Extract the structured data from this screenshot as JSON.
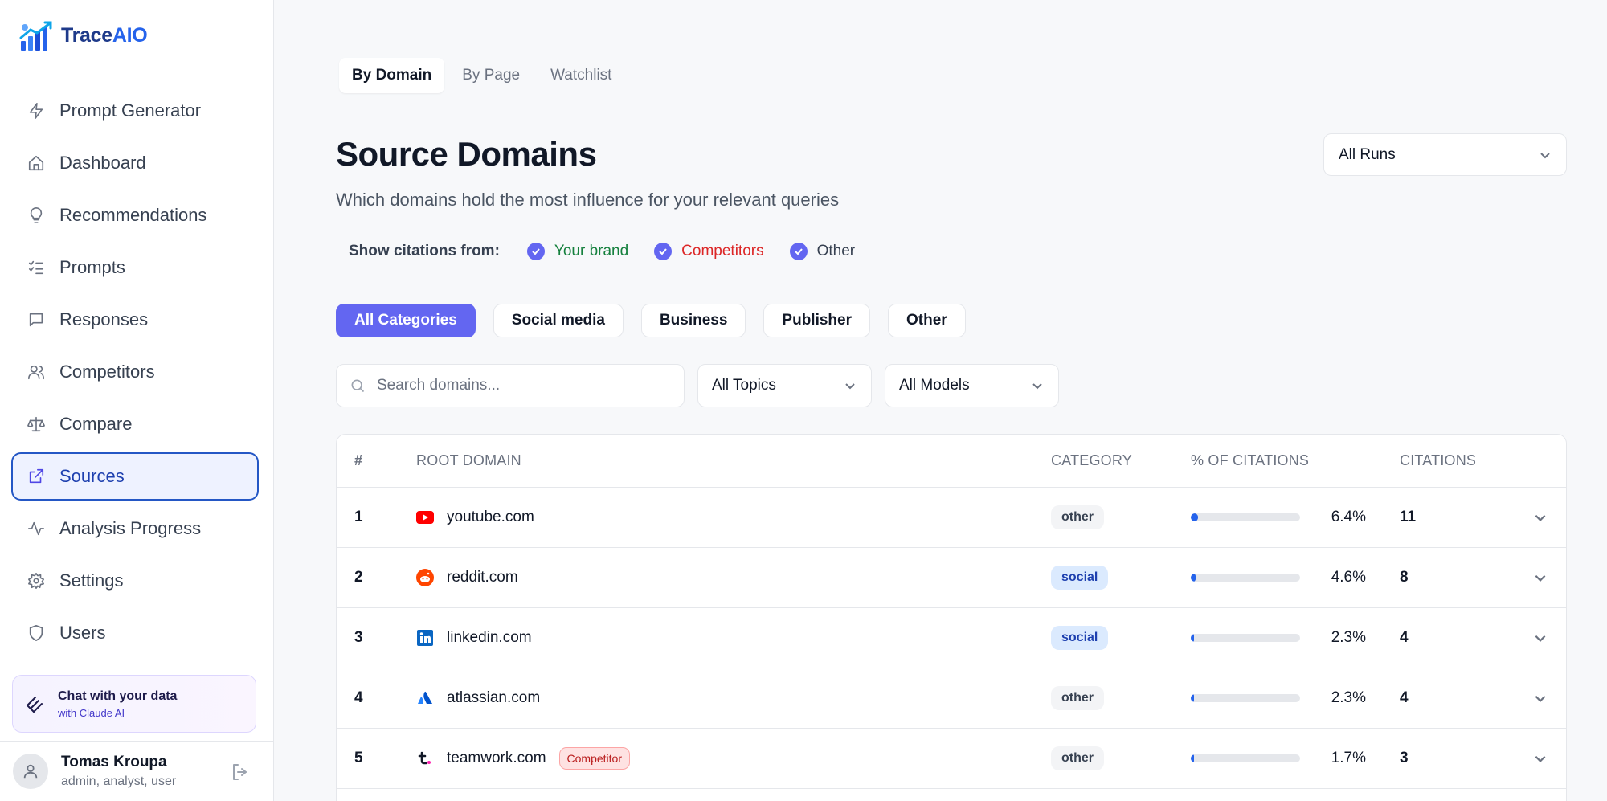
{
  "brand": {
    "name_prefix": "Trace",
    "name_suffix": "AIO"
  },
  "nav": [
    {
      "label": "Prompt Generator",
      "icon": "bolt-icon"
    },
    {
      "label": "Dashboard",
      "icon": "home-icon"
    },
    {
      "label": "Recommendations",
      "icon": "lightbulb-icon"
    },
    {
      "label": "Prompts",
      "icon": "checklist-icon"
    },
    {
      "label": "Responses",
      "icon": "message-icon"
    },
    {
      "label": "Competitors",
      "icon": "users-icon"
    },
    {
      "label": "Compare",
      "icon": "scale-icon"
    },
    {
      "label": "Sources",
      "icon": "external-link-icon",
      "active": true
    },
    {
      "label": "Analysis Progress",
      "icon": "activity-icon"
    },
    {
      "label": "Settings",
      "icon": "gear-icon"
    },
    {
      "label": "Users",
      "icon": "shield-icon"
    }
  ],
  "chat": {
    "title": "Chat with your data",
    "subtitle": "with Claude AI"
  },
  "user": {
    "name": "Tomas Kroupa",
    "roles": "admin, analyst, user"
  },
  "tabs": [
    "By Domain",
    "By Page",
    "Watchlist"
  ],
  "header": {
    "title": "Source Domains",
    "subtitle": "Which domains hold the most influence for your relevant queries",
    "runs_select": "All Runs"
  },
  "citations_filter": {
    "label": "Show citations from:",
    "options": [
      "Your brand",
      "Competitors",
      "Other"
    ]
  },
  "categories": [
    "All Categories",
    "Social media",
    "Business",
    "Publisher",
    "Other"
  ],
  "filters": {
    "search_placeholder": "Search domains...",
    "topics": "All Topics",
    "models": "All Models"
  },
  "table": {
    "headers": [
      "#",
      "ROOT DOMAIN",
      "CATEGORY",
      "% OF CITATIONS",
      "CITATIONS"
    ],
    "rows": [
      {
        "num": "1",
        "domain": "youtube.com",
        "category": "other",
        "pct": "6.4%",
        "pct_value": 6.4,
        "citations": "11",
        "competitor": ""
      },
      {
        "num": "2",
        "domain": "reddit.com",
        "category": "social",
        "pct": "4.6%",
        "pct_value": 4.6,
        "citations": "8",
        "competitor": ""
      },
      {
        "num": "3",
        "domain": "linkedin.com",
        "category": "social",
        "pct": "2.3%",
        "pct_value": 2.3,
        "citations": "4",
        "competitor": ""
      },
      {
        "num": "4",
        "domain": "atlassian.com",
        "category": "other",
        "pct": "2.3%",
        "pct_value": 2.3,
        "citations": "4",
        "competitor": ""
      },
      {
        "num": "5",
        "domain": "teamwork.com",
        "category": "other",
        "pct": "1.7%",
        "pct_value": 1.7,
        "citations": "3",
        "competitor": "Competitor"
      }
    ]
  },
  "colors": {
    "accent": "#6366f1",
    "brand_green": "#15803d",
    "competitor_red": "#dc2626",
    "bar": "#2563eb"
  }
}
